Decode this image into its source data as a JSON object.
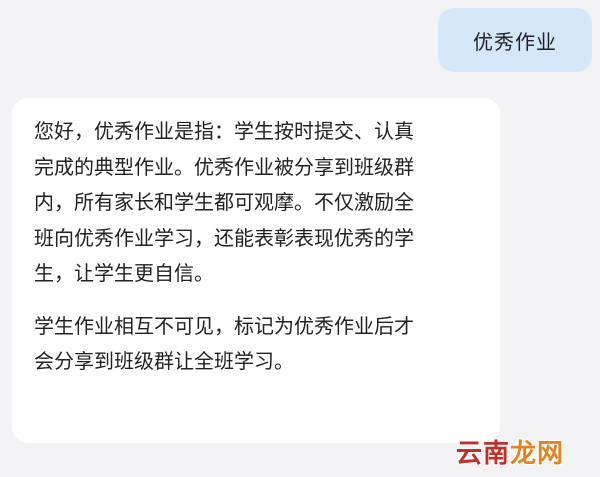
{
  "chat": {
    "user_message": "优秀作业",
    "bot_reply": {
      "paragraph_1_lines": [
        "您好，优秀作业是指：学生按时提交、认真",
        "完成的典型作业。优秀作业被分享到班级群",
        "内，所有家长和学生都可观摩。不仅激励全",
        "班向优秀作业学习，还能表彰表现优秀的学",
        "生，让学生更自信。"
      ],
      "paragraph_2_lines": [
        "学生作业相互不可见，标记为优秀作业后才",
        "会分享到班级群让全班学习。"
      ]
    }
  },
  "watermark": {
    "part_1": "云南",
    "part_2": "龙网"
  }
}
